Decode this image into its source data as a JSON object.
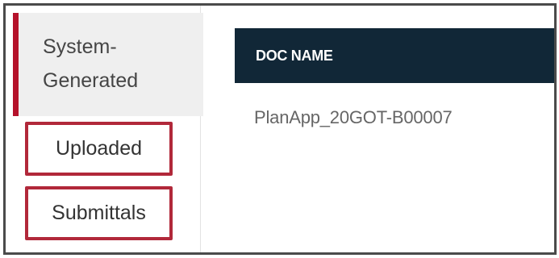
{
  "sidebar": {
    "active_tab": {
      "label": "System-Generated",
      "line1": "System-",
      "line2": "Generated"
    },
    "tabs": [
      {
        "label": "Uploaded"
      },
      {
        "label": "Submittals"
      }
    ]
  },
  "table": {
    "column_header": "DOC NAME",
    "rows": [
      {
        "doc_name": "PlanApp_20GOT-B00007"
      }
    ]
  },
  "colors": {
    "accent": "#b5122b",
    "highlight_box": "#b1283a",
    "header_bg": "#112737"
  }
}
